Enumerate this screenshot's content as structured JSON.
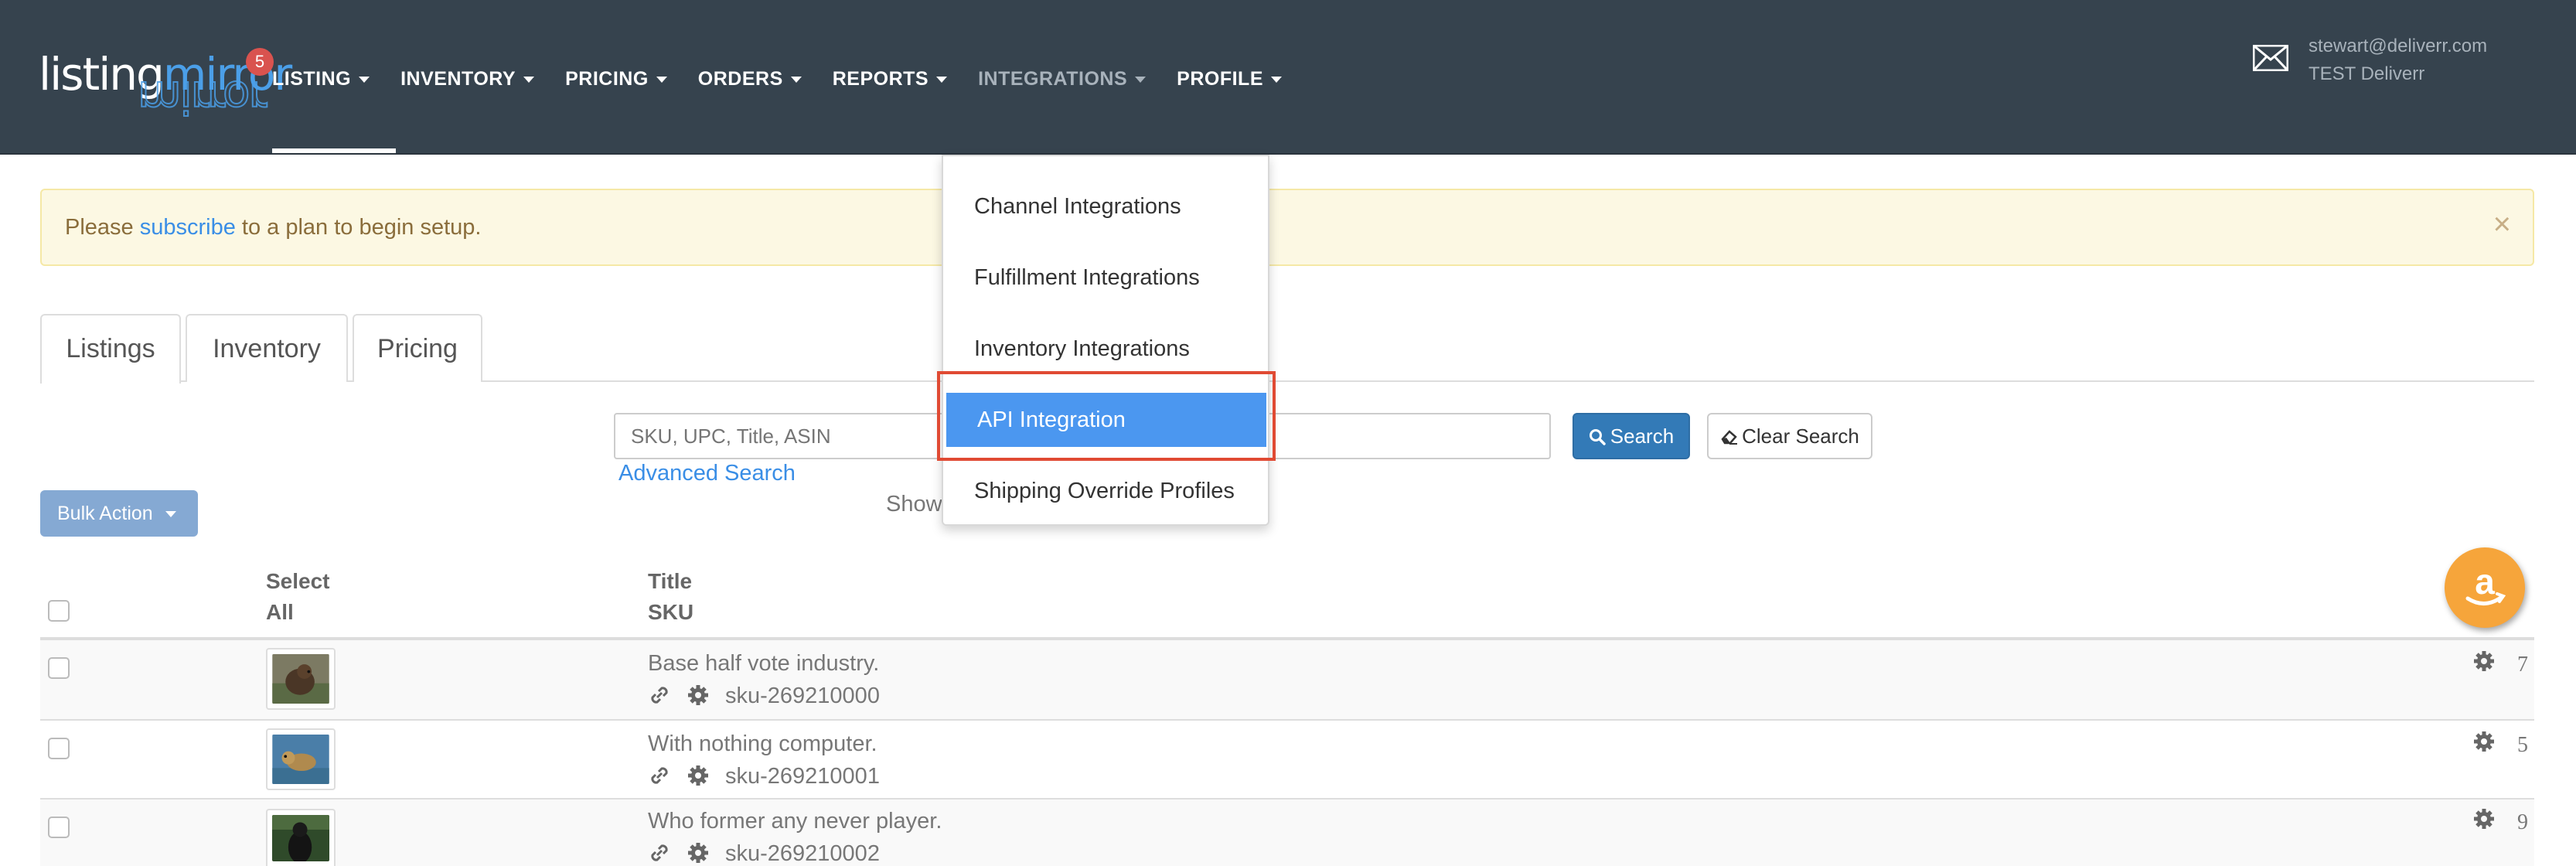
{
  "navbar": {
    "logo_text_listing": "listing",
    "logo_text_mirror": "mirror",
    "notification_count": "5",
    "items": [
      {
        "label": "LISTING",
        "state": "active"
      },
      {
        "label": "INVENTORY"
      },
      {
        "label": "PRICING"
      },
      {
        "label": "ORDERS"
      },
      {
        "label": "REPORTS"
      },
      {
        "label": "INTEGRATIONS",
        "state": "open"
      },
      {
        "label": "PROFILE"
      }
    ],
    "user_email": "stewart@deliverr.com",
    "user_org": "TEST Deliverr",
    "mail_icon": "envelope-icon"
  },
  "alert": {
    "prefix": "Please ",
    "link": "subscribe",
    "suffix": " to a plan to begin setup.",
    "close_label": "×"
  },
  "tabs": [
    {
      "label": "Listings",
      "active": true
    },
    {
      "label": "Inventory"
    },
    {
      "label": "Pricing"
    }
  ],
  "search": {
    "placeholder": "SKU, UPC, Title, ASIN",
    "search_label": "Search",
    "clear_label": "Clear Search",
    "advanced_label": "Advanced Search",
    "showing_text": "Show"
  },
  "bulk_action": {
    "label": "Bulk Action"
  },
  "integrations_menu": {
    "items": [
      {
        "label": "Channel Integrations"
      },
      {
        "label": "Fulfillment Integrations"
      },
      {
        "label": "Inventory Integrations"
      },
      {
        "label": "API Integration",
        "state": "hover"
      },
      {
        "label": "Shipping Override Profiles"
      }
    ]
  },
  "table": {
    "headers": {
      "select_line1": "Select",
      "select_line2": "All",
      "title_line1": "Title",
      "title_line2": "SKU"
    },
    "rows": [
      {
        "title": "Base half vote industry.",
        "sku": "sku-269210000",
        "qty": "7"
      },
      {
        "title": "With nothing computer.",
        "sku": "sku-269210001",
        "qty": "5"
      },
      {
        "title": "Who former any never player.",
        "sku": "sku-269210002",
        "qty": "9"
      }
    ]
  },
  "colors": {
    "navbar_bg": "#36434e",
    "accent_blue": "#337ab7",
    "menu_hover": "#4b97f0",
    "highlight_red": "#e04a33",
    "alert_bg": "#fcf8e3",
    "amazon_orange": "#f6a53b"
  }
}
